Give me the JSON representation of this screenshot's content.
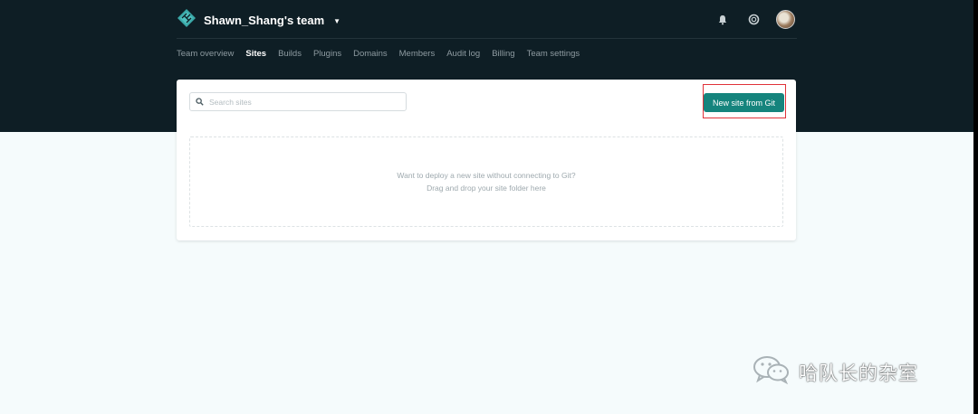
{
  "header": {
    "team_name": "Shawn_Shang's team",
    "icons": [
      "netlify-logo-icon",
      "bell-icon",
      "help-icon",
      "avatar"
    ]
  },
  "nav": {
    "tabs": [
      {
        "label": "Team overview",
        "active": false
      },
      {
        "label": "Sites",
        "active": true
      },
      {
        "label": "Builds",
        "active": false
      },
      {
        "label": "Plugins",
        "active": false
      },
      {
        "label": "Domains",
        "active": false
      },
      {
        "label": "Members",
        "active": false
      },
      {
        "label": "Audit log",
        "active": false
      },
      {
        "label": "Billing",
        "active": false
      },
      {
        "label": "Team settings",
        "active": false
      }
    ]
  },
  "sites": {
    "search_placeholder": "Search sites",
    "search_value": "",
    "new_site_label": "New site from Git",
    "drop_line1": "Want to deploy a new site without connecting to Git?",
    "drop_line2": "Drag and drop your site folder here"
  },
  "watermark": {
    "text": "哈队长的杂室"
  },
  "colors": {
    "header_bg": "#0e1e25",
    "page_bg": "#f5fbfc",
    "accent": "#15847d",
    "highlight": "#e0323a"
  }
}
